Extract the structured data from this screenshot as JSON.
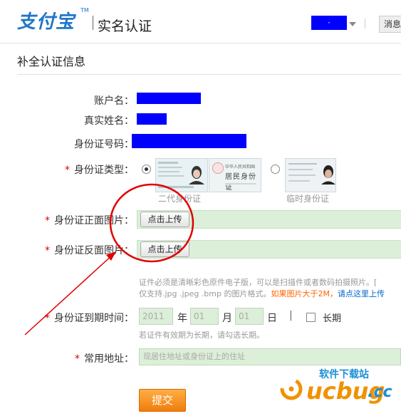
{
  "header": {
    "logo_text": "支付宝",
    "logo_tm": "TM",
    "title": "实名认证",
    "user_label": "-",
    "message_label": "消息"
  },
  "section": {
    "title": "补全认证信息"
  },
  "form": {
    "account_label": "账户名：",
    "realname_label": "真实姓名：",
    "idnumber_label": "身份证号码：",
    "idtype_label": "身份证类型：",
    "idtype_options": [
      {
        "caption": "二代身份证",
        "selected": true
      },
      {
        "caption": "临时身份证",
        "selected": false
      }
    ],
    "card_front_header": "中华人民共和国",
    "card_front_title": "居民身份证",
    "front_label": "身份证正面图片：",
    "back_label": "身份证反面图片：",
    "upload_button": "点击上传",
    "hint_line1": "证件必须是清晰彩色原件电子版，可以是扫描件或者数码拍摄照片。[",
    "hint_line2_plain": "仅支持.jpg .jpeg .bmp 的图片格式。",
    "hint_line2_orange": "如果图片大于2M，",
    "hint_line2_blue": "请点这里上传",
    "expiry_label": "身份证到期时间：",
    "year_value": "2011",
    "year_unit": "年",
    "month_value": "01",
    "month_unit": "月",
    "day_value": "01",
    "day_unit": "日",
    "divider": "|",
    "longterm_label": "长期",
    "expiry_hint": "若证件有效期为长期，请勾选长期。",
    "address_label": "常用地址：",
    "address_placeholder": "现居住地址或身份证上的住址",
    "required_mark": "*",
    "submit_label": "提交"
  },
  "watermark": {
    "brand": "ucbug",
    "suffix": ".cc",
    "tagline": "软件下载站"
  },
  "colors": {
    "accent_blue": "#1f76c9",
    "required_red": "#d00000",
    "field_green": "#dcefd8",
    "submit_orange": "#f5890f",
    "annotation_red": "#e00000",
    "watermark_orange": "#f29100",
    "watermark_blue": "#1a8fd6"
  }
}
